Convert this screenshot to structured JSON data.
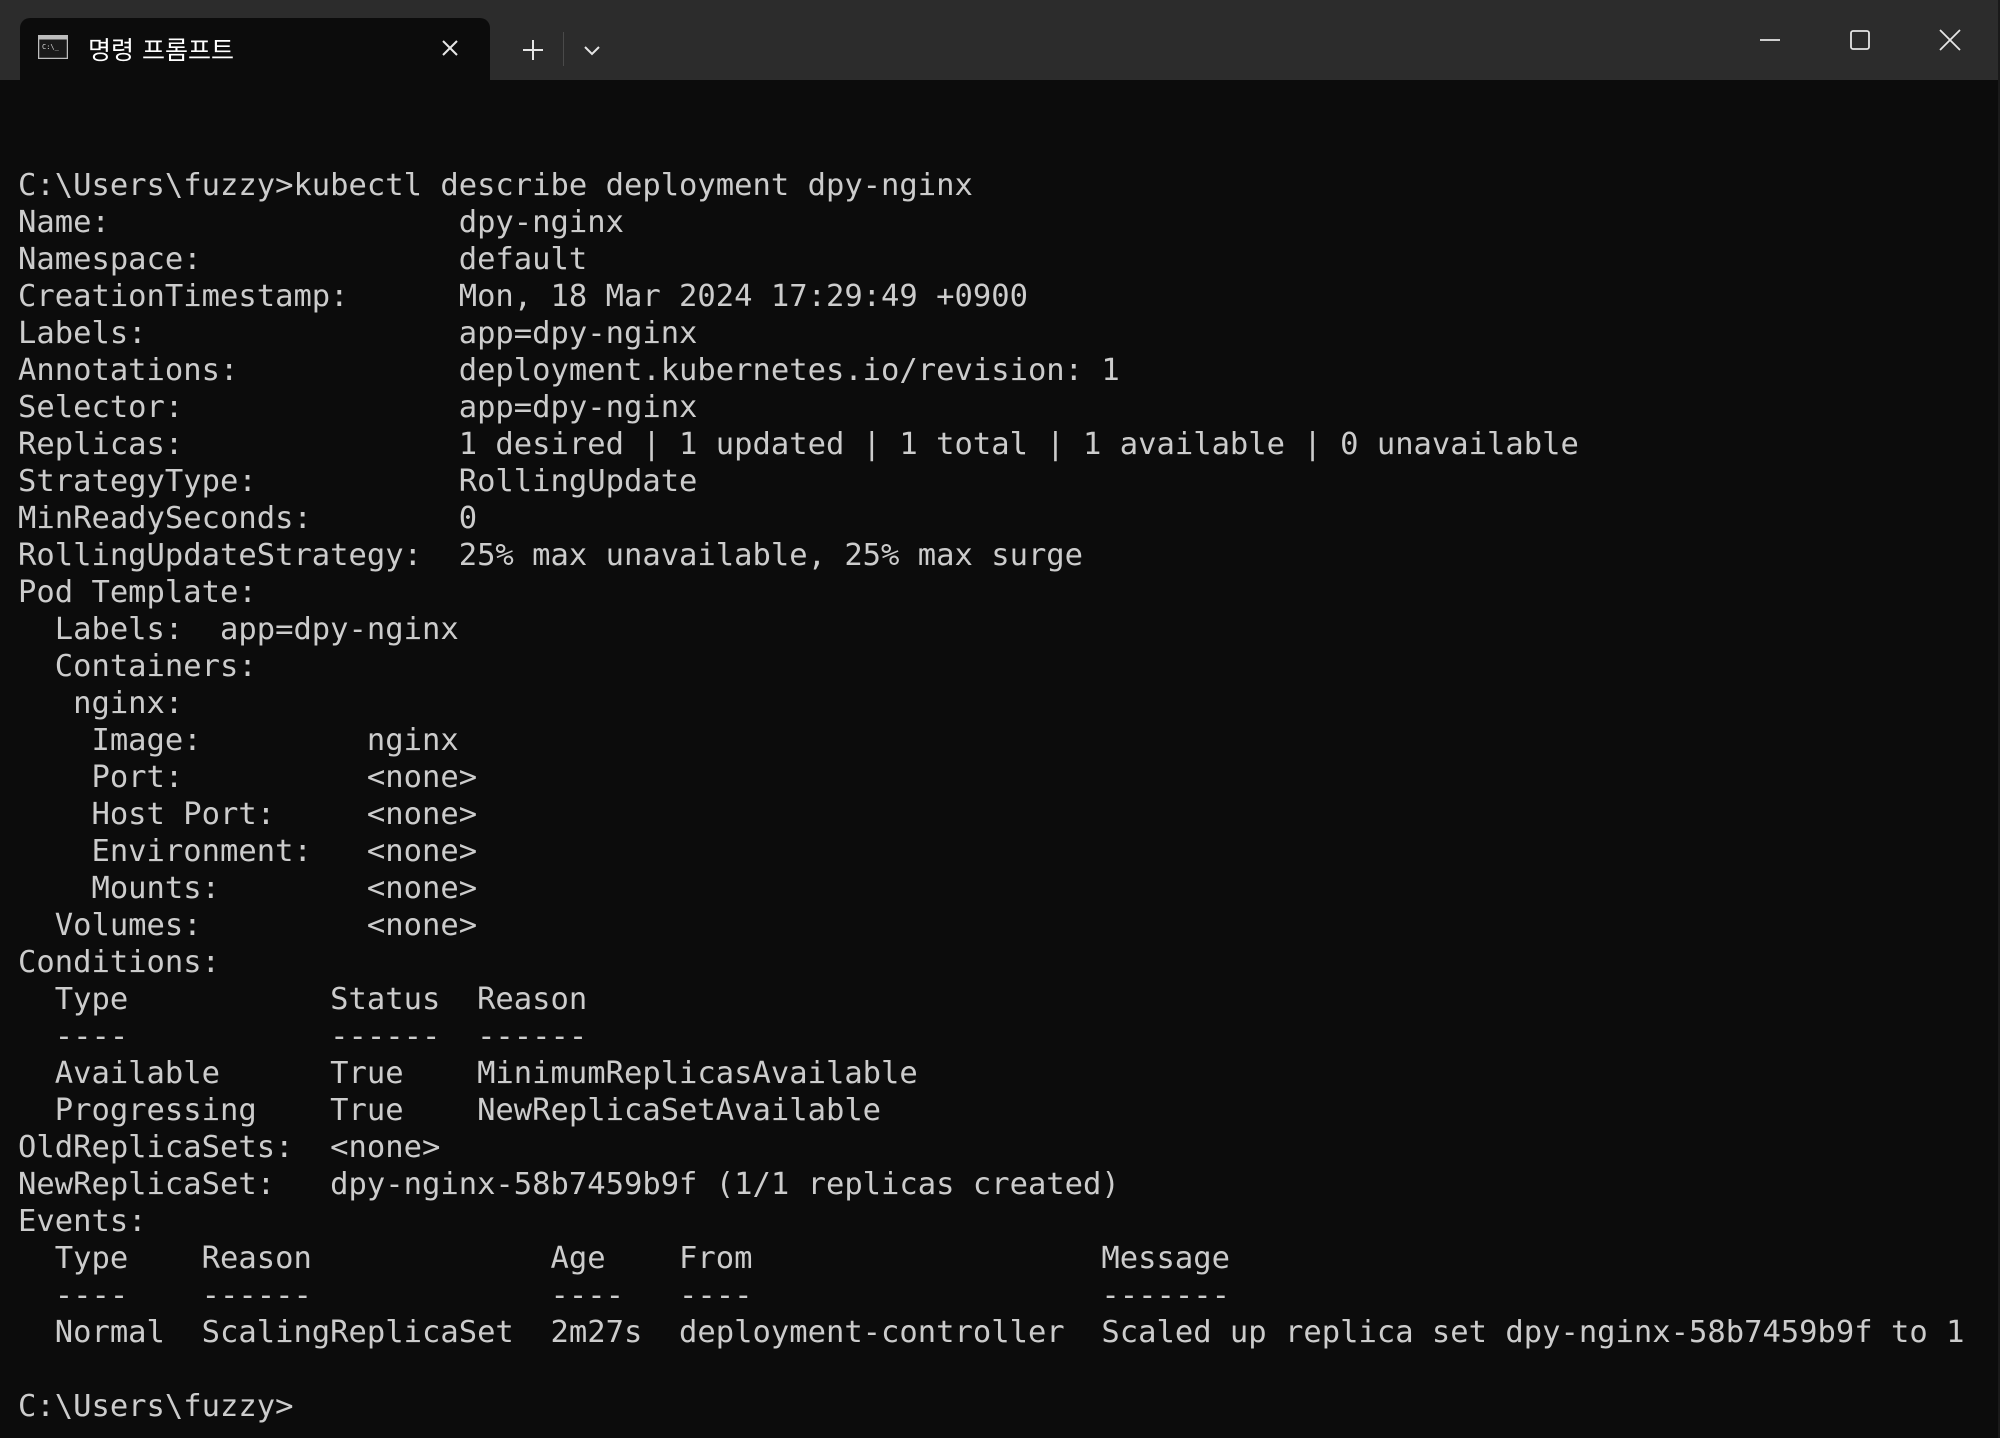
{
  "window": {
    "tab_title": "명령 프롬프트",
    "tab_icon": "console-icon",
    "new_tab_icon": "plus-icon",
    "dropdown_icon": "chevron-down-icon",
    "minimize_icon": "minimize-icon",
    "maximize_icon": "maximize-icon",
    "close_icon": "close-icon",
    "colors": {
      "titlebar": "#2c2c2c",
      "background": "#0c0c0c",
      "text": "#cccccc"
    }
  },
  "console": {
    "lines": [
      "",
      "C:\\Users\\fuzzy>kubectl describe deployment dpy-nginx",
      "Name:                   dpy-nginx",
      "Namespace:              default",
      "CreationTimestamp:      Mon, 18 Mar 2024 17:29:49 +0900",
      "Labels:                 app=dpy-nginx",
      "Annotations:            deployment.kubernetes.io/revision: 1",
      "Selector:               app=dpy-nginx",
      "Replicas:               1 desired | 1 updated | 1 total | 1 available | 0 unavailable",
      "StrategyType:           RollingUpdate",
      "MinReadySeconds:        0",
      "RollingUpdateStrategy:  25% max unavailable, 25% max surge",
      "Pod Template:",
      "  Labels:  app=dpy-nginx",
      "  Containers:",
      "   nginx:",
      "    Image:         nginx",
      "    Port:          <none>",
      "    Host Port:     <none>",
      "    Environment:   <none>",
      "    Mounts:        <none>",
      "  Volumes:         <none>",
      "Conditions:",
      "  Type           Status  Reason",
      "  ----           ------  ------",
      "  Available      True    MinimumReplicasAvailable",
      "  Progressing    True    NewReplicaSetAvailable",
      "OldReplicaSets:  <none>",
      "NewReplicaSet:   dpy-nginx-58b7459b9f (1/1 replicas created)",
      "Events:",
      "  Type    Reason             Age    From                   Message",
      "  ----    ------             ----   ----                   -------",
      "  Normal  ScalingReplicaSet  2m27s  deployment-controller  Scaled up replica set dpy-nginx-58b7459b9f to 1",
      "",
      "C:\\Users\\fuzzy>"
    ]
  }
}
